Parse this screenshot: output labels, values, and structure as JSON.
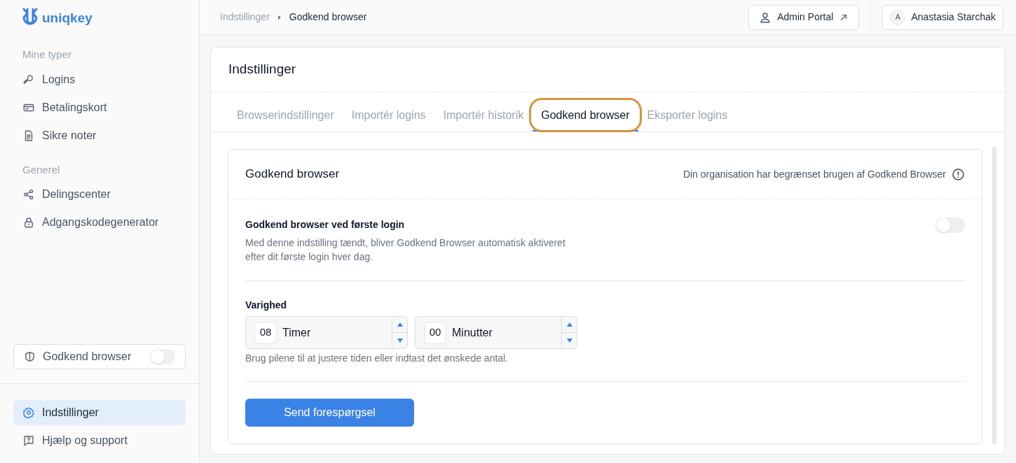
{
  "logo": {
    "text": "uniqkey"
  },
  "sidebar": {
    "sections": [
      {
        "heading": "Mine typer",
        "items": [
          {
            "label": "Logins",
            "selected": false
          },
          {
            "label": "Betalingskort",
            "selected": false
          },
          {
            "label": "Sikre noter",
            "selected": false
          }
        ]
      },
      {
        "heading": "Generel",
        "items": [
          {
            "label": "Delingscenter",
            "selected": false
          },
          {
            "label": "Adgangskodegenerator",
            "selected": false
          }
        ]
      }
    ],
    "approve_toggle": {
      "label": "Godkend browser",
      "on": false
    },
    "bottom_items": [
      {
        "label": "Indstillinger",
        "selected": true
      },
      {
        "label": "Hjælp og support",
        "selected": false
      }
    ]
  },
  "breadcrumb": [
    "Indstillinger",
    "Godkend browser"
  ],
  "admin_button": {
    "label": "Admin Portal"
  },
  "user": {
    "initial": "A",
    "name": "Anastasia Starchak"
  },
  "page_title": "Indstillinger",
  "tabs": [
    {
      "label": "Browserindstillinger",
      "selected": false,
      "highlighted": false
    },
    {
      "label": "Importér logins",
      "selected": false,
      "highlighted": false
    },
    {
      "label": "Importér historik",
      "selected": false,
      "highlighted": false
    },
    {
      "label": "Godkend browser",
      "selected": true,
      "highlighted": true
    },
    {
      "label": "Eksporter logins",
      "selected": false,
      "highlighted": false
    }
  ],
  "panel": {
    "title": "Godkend browser",
    "notice": "Din organisation har begrænset brugen af Godkend Browser",
    "setting": {
      "title": "Godkend browser ved første login",
      "description": "Med denne indstilling tændt, bliver Godkend Browser automatisk aktiveret efter dit første login hver dag.",
      "on": false
    },
    "duration": {
      "label": "Varighed",
      "fields": [
        {
          "value": "08",
          "unit": "Timer"
        },
        {
          "value": "00",
          "unit": "Minutter"
        }
      ],
      "hint": "Brug pilene til at justere tiden eller indtast det ønskede antal."
    },
    "submit": "Send forespørgsel"
  }
}
